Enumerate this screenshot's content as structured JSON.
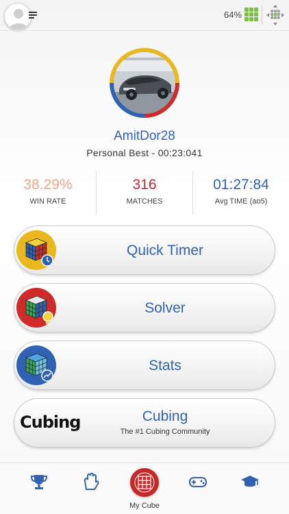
{
  "header": {
    "battery_text": "64%",
    "icons": [
      "profile-avatar-icon",
      "menu-icon",
      "cube-battery-icon",
      "cube-navigation-icon"
    ]
  },
  "profile": {
    "username": "AmitDor28",
    "personal_best": "Personal Best - 00:23:041"
  },
  "stats": [
    {
      "value": "38.29%",
      "label": "WIN RATE",
      "color": "#f0a58a"
    },
    {
      "value": "316",
      "label": "MATCHES",
      "color": "#c62834"
    },
    {
      "value": "01:27:84",
      "label": "Avg TIME (ao5)",
      "color": "#2f62b3"
    }
  ],
  "actions": {
    "quick_timer": {
      "label": "Quick Timer"
    },
    "solver": {
      "label": "Solver"
    },
    "stats": {
      "label": "Stats"
    },
    "cubing": {
      "label": "Cubing",
      "subtitle": "The #1 Cubing Community",
      "logo_text": "Cubing"
    }
  },
  "bottom_nav": {
    "active_label": "My Cube"
  },
  "colors": {
    "accent_blue": "#2f62b3",
    "accent_red": "#c62828",
    "cube_yellow": "#e8b81e",
    "battery_green": "#7ac143"
  }
}
